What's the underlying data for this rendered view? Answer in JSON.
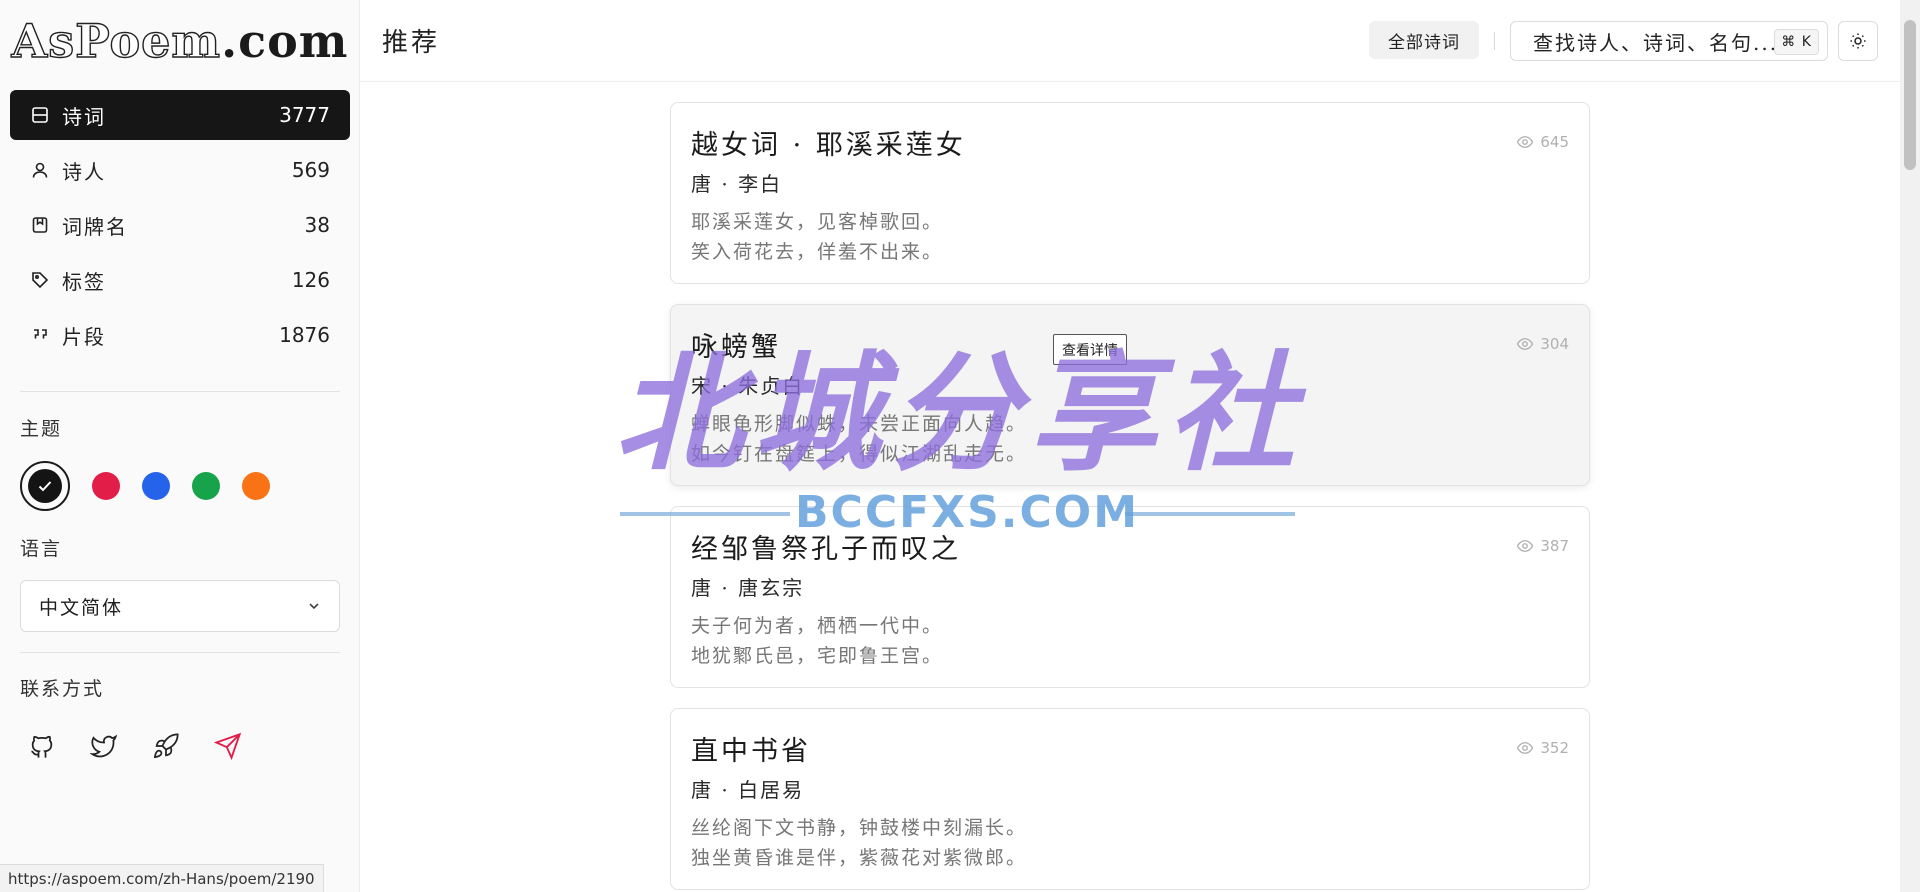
{
  "logo": {
    "text": "AsPoem",
    "suffix": ".com"
  },
  "nav": [
    {
      "label": "诗词",
      "count": "3777",
      "icon": "layout-icon",
      "active": true
    },
    {
      "label": "诗人",
      "count": "569",
      "icon": "user-icon",
      "active": false
    },
    {
      "label": "词牌名",
      "count": "38",
      "icon": "bookmark-icon",
      "active": false
    },
    {
      "label": "标签",
      "count": "126",
      "icon": "tag-icon",
      "active": false
    },
    {
      "label": "片段",
      "count": "1876",
      "icon": "quote-icon",
      "active": false
    }
  ],
  "theme": {
    "title": "主题",
    "colors": [
      "#141414",
      "#e11d48",
      "#2563eb",
      "#16a34a",
      "#f97316"
    ],
    "selected": 0
  },
  "language": {
    "title": "语言",
    "value": "中文简体"
  },
  "contact": {
    "title": "联系方式",
    "icons": [
      "github-icon",
      "twitter-icon",
      "rocket-icon",
      "telegram-icon"
    ]
  },
  "status_url": "https://aspoem.com/zh-Hans/poem/2190",
  "header": {
    "title": "推荐",
    "all_poems": "全部诗词",
    "search_placeholder": "查找诗人、诗词、名句...",
    "shortcut": "⌘ K"
  },
  "tooltip": "查看详情",
  "poems": [
    {
      "title": "越女词 · 耶溪采莲女",
      "meta": "唐 · 李白",
      "lines": [
        "耶溪采莲女，见客棹歌回。",
        "笑入荷花去，佯羞不出来。"
      ],
      "views": "645"
    },
    {
      "title": "咏螃蟹",
      "meta": "宋 · 朱贞白",
      "lines": [
        "蝉眼龟形脚似蛛，未尝正面向人趋。",
        "如今钉在盘筵上，得似江湖乱走无。"
      ],
      "views": "304"
    },
    {
      "title": "经邹鲁祭孔子而叹之",
      "meta": "唐 · 唐玄宗",
      "lines": [
        "夫子何为者，栖栖一代中。",
        "地犹鄹氏邑，宅即鲁王宫。"
      ],
      "views": "387"
    },
    {
      "title": "直中书省",
      "meta": "唐 · 白居易",
      "lines": [
        "丝纶阁下文书静，钟鼓楼中刻漏长。",
        "独坐黄昏谁是伴，紫薇花对紫微郎。"
      ],
      "views": "352"
    }
  ],
  "watermark": {
    "title": "北城分享社",
    "subtitle": "BCCFXS.COM"
  }
}
